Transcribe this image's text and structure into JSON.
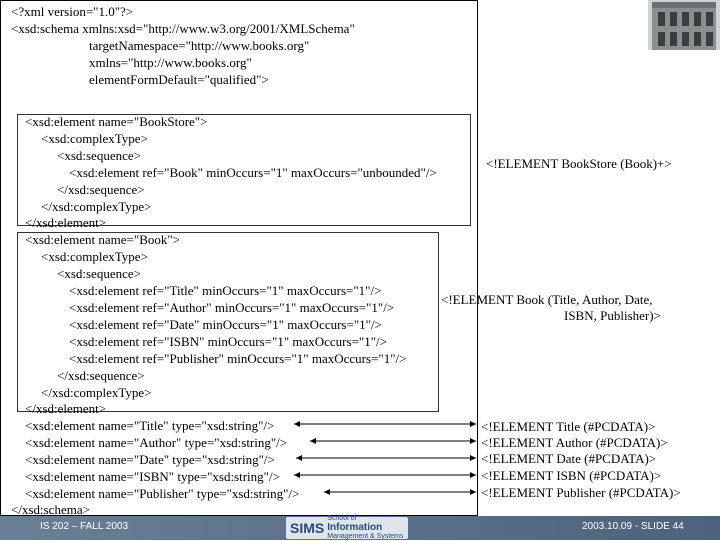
{
  "code_lines": [
    "<?xml version=\"1.0\"?>",
    "<xsd:schema xmlns:xsd=\"http://www.w3.org/2001/XMLSchema\"",
    "targetNamespace=\"http://www.books.org\"",
    "xmlns=\"http://www.books.org\"",
    "elementFormDefault=\"qualified\">",
    "<xsd:element name=\"BookStore\">",
    "<xsd:complexType>",
    "<xsd:sequence>",
    "<xsd:element ref=\"Book\" minOccurs=\"1\" maxOccurs=\"unbounded\"/>",
    "</xsd:sequence>",
    "</xsd:complexType>",
    "</xsd:element>",
    "<xsd:element name=\"Book\">",
    "<xsd:complexType>",
    "<xsd:sequence>",
    "<xsd:element ref=\"Title\" minOccurs=\"1\" maxOccurs=\"1\"/>",
    "<xsd:element ref=\"Author\" minOccurs=\"1\" maxOccurs=\"1\"/>",
    "<xsd:element ref=\"Date\" minOccurs=\"1\" maxOccurs=\"1\"/>",
    "<xsd:element ref=\"ISBN\" minOccurs=\"1\" maxOccurs=\"1\"/>",
    "<xsd:element ref=\"Publisher\" minOccurs=\"1\" maxOccurs=\"1\"/>",
    "</xsd:sequence>",
    "</xsd:complexType>",
    "</xsd:element>",
    "<xsd:element name=\"Title\" type=\"xsd:string\"/>",
    "<xsd:element name=\"Author\" type=\"xsd:string\"/>",
    "<xsd:element name=\"Date\" type=\"xsd:string\"/>",
    "<xsd:element name=\"ISBN\" type=\"xsd:string\"/>",
    "<xsd:element name=\"Publisher\" type=\"xsd:string\"/>",
    "</xsd:schema>"
  ],
  "dtd": {
    "bookstore": "<!ELEMENT BookStore (Book)+>",
    "book_line1": "<!ELEMENT Book (Title, Author, Date,",
    "book_line2": "ISBN, Publisher)>",
    "title": "<!ELEMENT Title (#PCDATA)>",
    "author": "<!ELEMENT Author (#PCDATA)>",
    "date": "<!ELEMENT Date (#PCDATA)>",
    "isbn": "<!ELEMENT ISBN (#PCDATA)>",
    "publisher": "<!ELEMENT Publisher (#PCDATA)>"
  },
  "footer": {
    "left": "IS 202 – FALL 2003",
    "right": "2003.10.09 - SLIDE 44",
    "logo_main": "SIMS",
    "logo_small_top": "School of",
    "logo_big": "Information",
    "logo_small_bottom": "Management & Systems"
  },
  "colors": {
    "footer_bar": "#4d627c",
    "logo_text": "#2a4a7a"
  }
}
